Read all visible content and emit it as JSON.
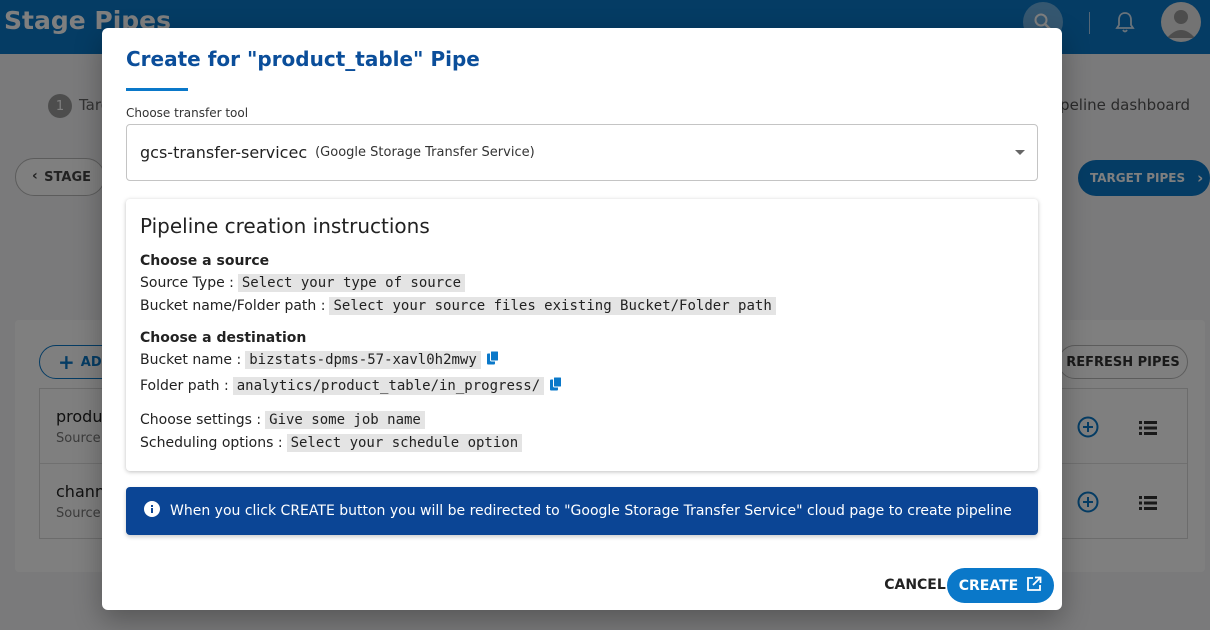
{
  "app": {
    "title": "Stage Pipes",
    "step_number": "1",
    "step_label": "Targ",
    "pipeline_link": "ipeline dashboard",
    "stage_button": "STAGE",
    "target_pipes_button": "TARGET PIPES",
    "add_button": "AD",
    "refresh_button": "REFRESH PIPES",
    "rows": [
      {
        "name": "produ",
        "sub": "Source"
      },
      {
        "name": "chann",
        "sub": "Source"
      }
    ]
  },
  "dialog": {
    "title": "Create for \"product_table\" Pipe",
    "tool_label": "Choose transfer tool",
    "tool_value": "gcs-transfer-servicec",
    "tool_desc": "(Google Storage Transfer Service)",
    "instructions": {
      "title": "Pipeline creation instructions",
      "source_head": "Choose a source",
      "source_type_label": "Source Type :",
      "source_type_value": "Select your type of source",
      "bucket_folder_label": "Bucket name/Folder path :",
      "bucket_folder_value": "Select your source files existing Bucket/Folder path",
      "dest_head": "Choose a destination",
      "bucket_name_label": "Bucket name :",
      "bucket_name_value": "bizstats-dpms-57-xavl0h2mwy",
      "folder_path_label": "Folder path :",
      "folder_path_value": "analytics/product_table/in_progress/",
      "settings_label": "Choose settings :",
      "settings_value": "Give some job name",
      "scheduling_label": "Scheduling options :",
      "scheduling_value": "Select your schedule option"
    },
    "info_text": "When you click CREATE button you will be redirected to \"Google Storage Transfer Service\" cloud page to create pipeline",
    "cancel_label": "CANCEL",
    "create_label": "CREATE"
  },
  "colors": {
    "primary": "#0a78c9",
    "title_blue": "#0b4e9a",
    "banner": "#0b4595"
  },
  "icons": [
    "search-icon",
    "bell-icon",
    "avatar-icon",
    "chevron-left-icon",
    "chevron-right-icon",
    "plus-icon",
    "add-circle-icon",
    "list-icon",
    "copy-icon",
    "info-icon",
    "open-external-icon",
    "dropdown-arrow-icon"
  ]
}
